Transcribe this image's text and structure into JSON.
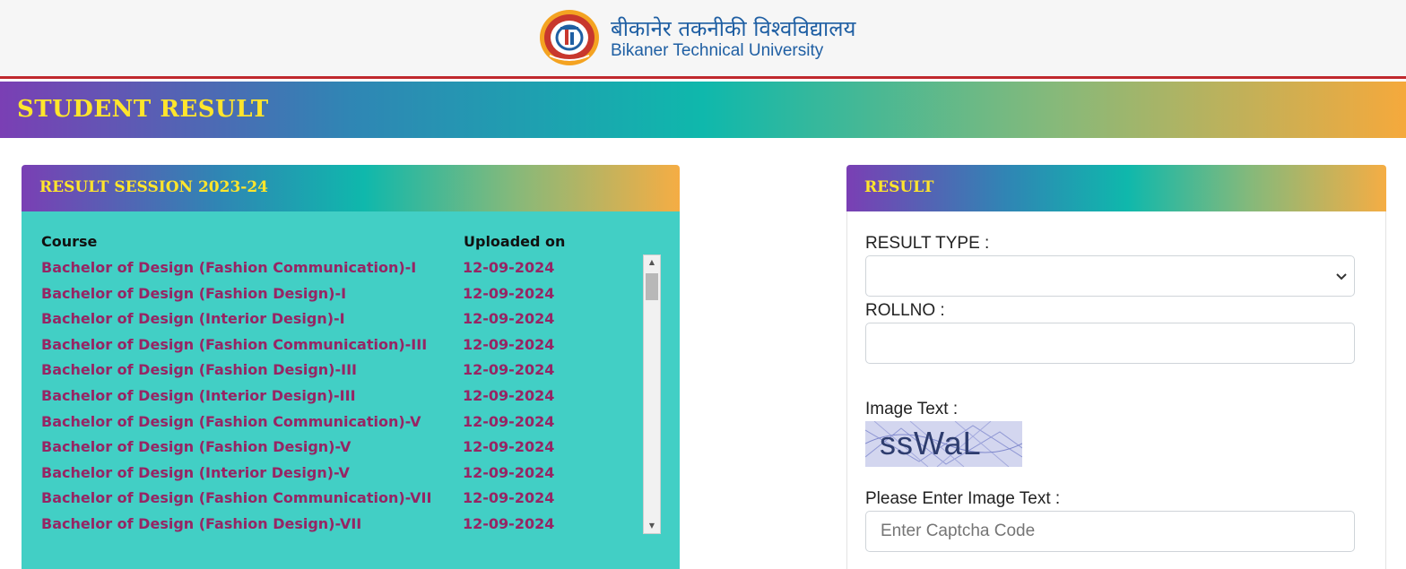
{
  "header": {
    "university_hindi": "बीकानेर तकनीकी विश्वविद्यालय",
    "university_english": "Bikaner Technical University"
  },
  "banner": {
    "title": "STUDENT RESULT"
  },
  "session_panel": {
    "title": "RESULT SESSION 2023-24",
    "columns": {
      "course": "Course",
      "uploaded": "Uploaded on"
    },
    "rows": [
      {
        "course": "Bachelor of Design (Fashion Communication)-I",
        "date": "12-09-2024"
      },
      {
        "course": "Bachelor of Design (Fashion Design)-I",
        "date": "12-09-2024"
      },
      {
        "course": "Bachelor of Design (Interior Design)-I",
        "date": "12-09-2024"
      },
      {
        "course": "Bachelor of Design (Fashion Communication)-III",
        "date": "12-09-2024"
      },
      {
        "course": "Bachelor of Design (Fashion Design)-III",
        "date": "12-09-2024"
      },
      {
        "course": "Bachelor of Design (Interior Design)-III",
        "date": "12-09-2024"
      },
      {
        "course": "Bachelor of Design (Fashion Communication)-V",
        "date": "12-09-2024"
      },
      {
        "course": "Bachelor of Design (Fashion Design)-V",
        "date": "12-09-2024"
      },
      {
        "course": "Bachelor of Design (Interior Design)-V",
        "date": "12-09-2024"
      },
      {
        "course": "Bachelor of Design (Fashion Communication)-VII",
        "date": "12-09-2024"
      },
      {
        "course": "Bachelor of Design (Fashion Design)-VII",
        "date": "12-09-2024"
      }
    ]
  },
  "result_panel": {
    "title": "RESULT",
    "result_type_label": "RESULT TYPE :",
    "result_type_value": "",
    "rollno_label": "ROLLNO :",
    "rollno_value": "",
    "image_text_label": "Image Text :",
    "captcha_text": "ssWaL",
    "enter_image_text_label": "Please Enter Image Text :",
    "captcha_placeholder": "Enter Captcha Code"
  },
  "colors": {
    "banner_text": "#ffe52c",
    "course_link": "#962564",
    "panel_body": "#42cfc5",
    "header_border": "#c0282d",
    "brand_blue": "#1f5fa3"
  },
  "icons": {
    "logo": "btu-seal-logo",
    "select": "chevron-down-icon",
    "scroll_up": "scroll-up-arrow-icon",
    "scroll_down": "scroll-down-arrow-icon"
  }
}
